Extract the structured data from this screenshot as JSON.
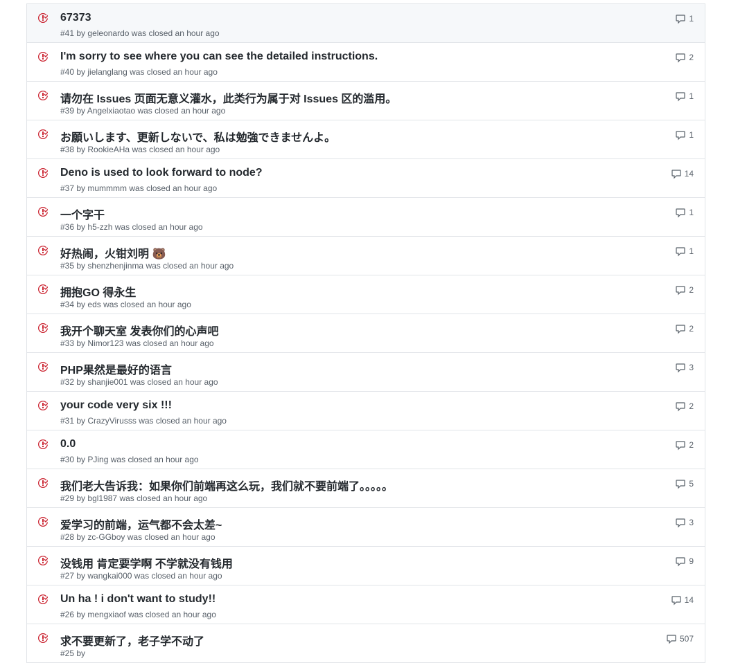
{
  "colors": {
    "closed_icon": "#cb2431",
    "border": "#e1e4e8",
    "muted": "#586069"
  },
  "issues": [
    {
      "title": "67373",
      "number": "#41",
      "author": "geleonardo",
      "status": "was closed",
      "time": "an hour ago",
      "comments": "1"
    },
    {
      "title": "I'm sorry to see where you can see the detailed instructions.",
      "number": "#40",
      "author": "jielanglang",
      "status": "was closed",
      "time": "an hour ago",
      "comments": "2"
    },
    {
      "title": "请勿在 Issues 页面无意义灌水，此类行为属于对 Issues 区的滥用。",
      "number": "#39",
      "author": "Angelxiaotao",
      "status": "was closed",
      "time": "an hour ago",
      "comments": "1"
    },
    {
      "title": "お願いします、更新しないで、私は勉強できませんよ。",
      "number": "#38",
      "author": "RookieAHa",
      "status": "was closed",
      "time": "an hour ago",
      "comments": "1"
    },
    {
      "title": "Deno is used to look forward to node?",
      "number": "#37",
      "author": "mummmm",
      "status": "was closed",
      "time": "an hour ago",
      "comments": "14"
    },
    {
      "title": "一个字干",
      "number": "#36",
      "author": "h5-zzh",
      "status": "was closed",
      "time": "an hour ago",
      "comments": "1"
    },
    {
      "title": "好热闹，火钳刘明 🐻",
      "number": "#35",
      "author": "shenzhenjinma",
      "status": "was closed",
      "time": "an hour ago",
      "comments": "1"
    },
    {
      "title": "拥抱GO 得永生",
      "number": "#34",
      "author": "eds",
      "status": "was closed",
      "time": "an hour ago",
      "comments": "2"
    },
    {
      "title": "我开个聊天室 发表你们的心声吧",
      "number": "#33",
      "author": "Nimor123",
      "status": "was closed",
      "time": "an hour ago",
      "comments": "2"
    },
    {
      "title": "PHP果然是最好的语言",
      "number": "#32",
      "author": "shanjie001",
      "status": "was closed",
      "time": "an hour ago",
      "comments": "3"
    },
    {
      "title": "your code very six !!!",
      "number": "#31",
      "author": "CrazyVirusss",
      "status": "was closed",
      "time": "an hour ago",
      "comments": "2"
    },
    {
      "title": "0.0",
      "number": "#30",
      "author": "PJing",
      "status": "was closed",
      "time": "an hour ago",
      "comments": "2"
    },
    {
      "title": "我们老大告诉我：如果你们前端再这么玩，我们就不要前端了。。。。。",
      "number": "#29",
      "author": "bgl1987",
      "status": "was closed",
      "time": "an hour ago",
      "comments": "5"
    },
    {
      "title": "爱学习的前端，运气都不会太差~",
      "number": "#28",
      "author": "zc-GGboy",
      "status": "was closed",
      "time": "an hour ago",
      "comments": "3"
    },
    {
      "title": "没钱用 肯定要学啊 不学就没有钱用",
      "number": "#27",
      "author": "wangkai000",
      "status": "was closed",
      "time": "an hour ago",
      "comments": "9"
    },
    {
      "title": "Un ha ! i don't want to study!!",
      "number": "#26",
      "author": "mengxiaof",
      "status": "was closed",
      "time": "an hour ago",
      "comments": "14"
    },
    {
      "title": "求不要更新了，老子学不动了",
      "number": "#25",
      "author": "",
      "status": "",
      "time": "",
      "comments": "507"
    }
  ]
}
